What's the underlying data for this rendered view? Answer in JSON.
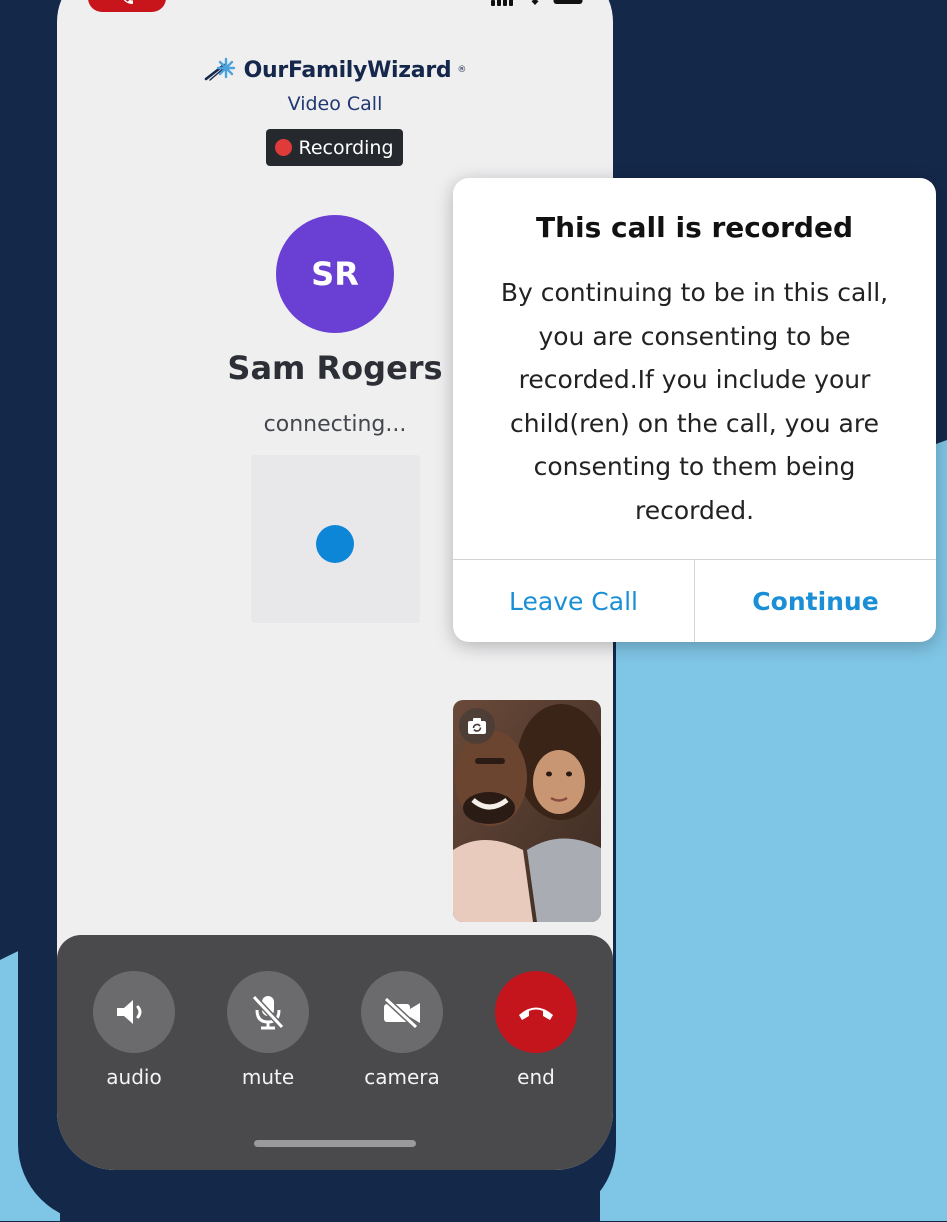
{
  "app": {
    "brand_name": "OurFamilyWizard",
    "brand_mark": "®",
    "subtitle": "Video Call"
  },
  "status_bar": {
    "call_icon": "phone-icon",
    "icons": [
      "signal-icon",
      "wifi-icon",
      "battery-icon"
    ]
  },
  "recording_badge": {
    "label": "Recording"
  },
  "caller": {
    "initials": "SR",
    "name": "Sam Rogers",
    "status": "connecting..."
  },
  "controls": [
    {
      "id": "audio",
      "label": "audio",
      "icon": "speaker-icon"
    },
    {
      "id": "mute",
      "label": "mute",
      "icon": "mic-off-icon"
    },
    {
      "id": "camera",
      "label": "camera",
      "icon": "camera-off-icon"
    },
    {
      "id": "end",
      "label": "end",
      "icon": "hang-up-icon"
    }
  ],
  "dialog": {
    "title": "This call is recorded",
    "body_lines": [
      "By continuing to be in this call,",
      "you are consenting to be",
      "recorded.If you include your",
      "child(ren) on the call, you are",
      "consenting to them being",
      "recorded."
    ],
    "leave_label": "Leave Call",
    "continue_label": "Continue"
  },
  "colors": {
    "navy_background": "#14284a",
    "light_blue_background": "#7fc5e5",
    "accent_blue": "#1a8fd6",
    "end_call_red": "#c4151c",
    "avatar_purple": "#6a3fd3"
  }
}
